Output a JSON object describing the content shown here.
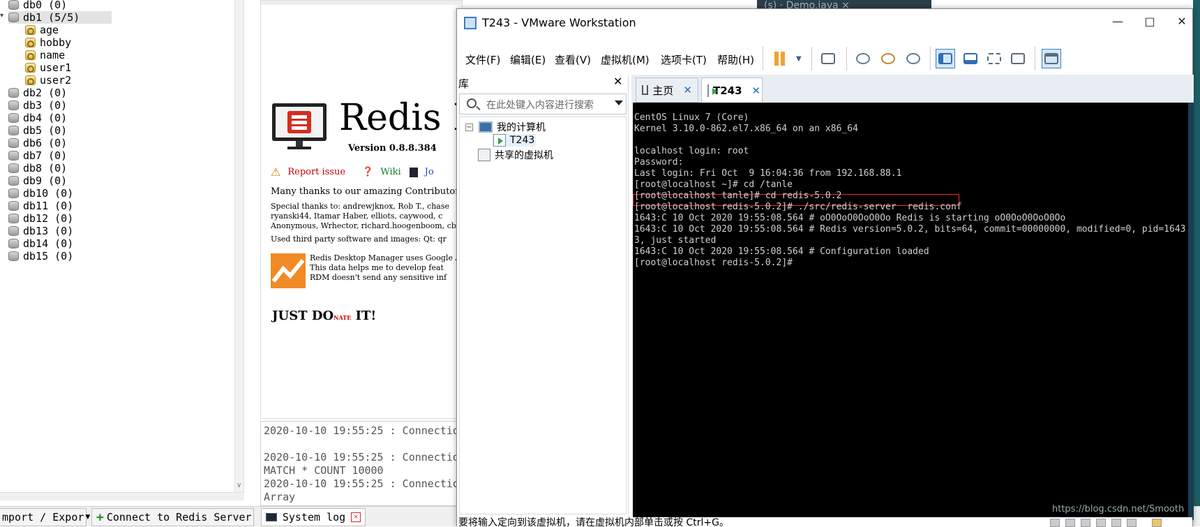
{
  "rdm": {
    "tree": {
      "items": [
        {
          "label": "db0  (0)",
          "type": "db"
        },
        {
          "label": "db1  (5/5)",
          "type": "db",
          "selected": true
        },
        {
          "label": "age",
          "type": "key"
        },
        {
          "label": "hobby",
          "type": "key"
        },
        {
          "label": "name",
          "type": "key"
        },
        {
          "label": "user1",
          "type": "key"
        },
        {
          "label": "user2",
          "type": "key"
        },
        {
          "label": "db2  (0)",
          "type": "db"
        },
        {
          "label": "db3  (0)",
          "type": "db"
        },
        {
          "label": "db4  (0)",
          "type": "db"
        },
        {
          "label": "db5  (0)",
          "type": "db"
        },
        {
          "label": "db6  (0)",
          "type": "db"
        },
        {
          "label": "db7  (0)",
          "type": "db"
        },
        {
          "label": "db8  (0)",
          "type": "db"
        },
        {
          "label": "db9  (0)",
          "type": "db"
        },
        {
          "label": "db10  (0)",
          "type": "db"
        },
        {
          "label": "db11  (0)",
          "type": "db"
        },
        {
          "label": "db12  (0)",
          "type": "db"
        },
        {
          "label": "db13  (0)",
          "type": "db"
        },
        {
          "label": "db14  (0)",
          "type": "db"
        },
        {
          "label": "db15  (0)",
          "type": "db"
        }
      ]
    },
    "bottom": {
      "import_export": "mport / Expor",
      "connect": "Connect to Redis Server",
      "system_log": "System log"
    },
    "welcome": {
      "title": "Redis I",
      "version": "Version 0.8.8.384",
      "report_issue": "Report issue",
      "wiki": "Wiki",
      "join": "Jo",
      "thanks": "Many thanks to our amazing Contributor",
      "special_thanks": "Special thanks to: andrewjknox, Rob T., chase",
      "special_thanks_2": "ryanski44, Itamar Haber, elliots, caywood, c",
      "special_thanks_3": "Anonymous, Wrhector, richard.hoogenboom, cbl",
      "third_party": "Used third party software and images: Qt: qr",
      "ga_1": "Redis Desktop Manager uses Google A",
      "ga_2": "This data helps me to develop feat",
      "ga_3": "RDM doesn't send any sensitive inf",
      "donate": "JUST DO",
      "donate_small": "NATE",
      "donate_end": " IT!"
    },
    "log": {
      "lines": [
        "2020-10-10 19:55:25 : Connectio",
        "",
        "2020-10-10 19:55:25 : Connectio",
        "MATCH * COUNT 10000",
        "2020-10-10 19:55:25 : Connectio",
        "Array"
      ]
    },
    "background_tab": "(s) ·  Demo.java  ×"
  },
  "vmware": {
    "title": "T243 - VMware Workstation",
    "menu": [
      "文件(F)",
      "编辑(E)",
      "查看(V)",
      "虚拟机(M)",
      "选项卡(T)",
      "帮助(H)"
    ],
    "library": {
      "header": "库",
      "search_placeholder": "在此处键入内容进行搜索",
      "my_computer": "我的计算机",
      "vm": "T243",
      "shared": "共享的虚拟机"
    },
    "tabs": {
      "home": "主页",
      "vm": "T243"
    },
    "console": [
      "CentOS Linux 7 (Core)",
      "Kernel 3.10.0-862.el7.x86_64 on an x86_64",
      "",
      "localhost login: root",
      "Password:",
      "Last login: Fri Oct  9 16:04:36 from 192.168.88.1",
      "[root@localhost ~]# cd /tanle",
      "[root@localhost tanle]# cd redis-5.0.2",
      "[root@localhost redis-5.0.2]# ./src/redis-server  redis.conf",
      "1643:C 10 Oct 2020 19:55:08.564 # oO0OoO0OoO0Oo Redis is starting oO0OoO0OoO0Oo",
      "1643:C 10 Oct 2020 19:55:08.564 # Redis version=5.0.2, bits=64, commit=00000000, modified=0, pid=1643",
      "3, just started",
      "1643:C 10 Oct 2020 19:55:08.564 # Configuration loaded",
      "[root@localhost redis-5.0.2]#"
    ],
    "status": "要将输入定向到该虚拟机，请在虚拟机内部单击或按 Ctrl+G。"
  },
  "watermark": "https://blog.csdn.net/Smooth"
}
